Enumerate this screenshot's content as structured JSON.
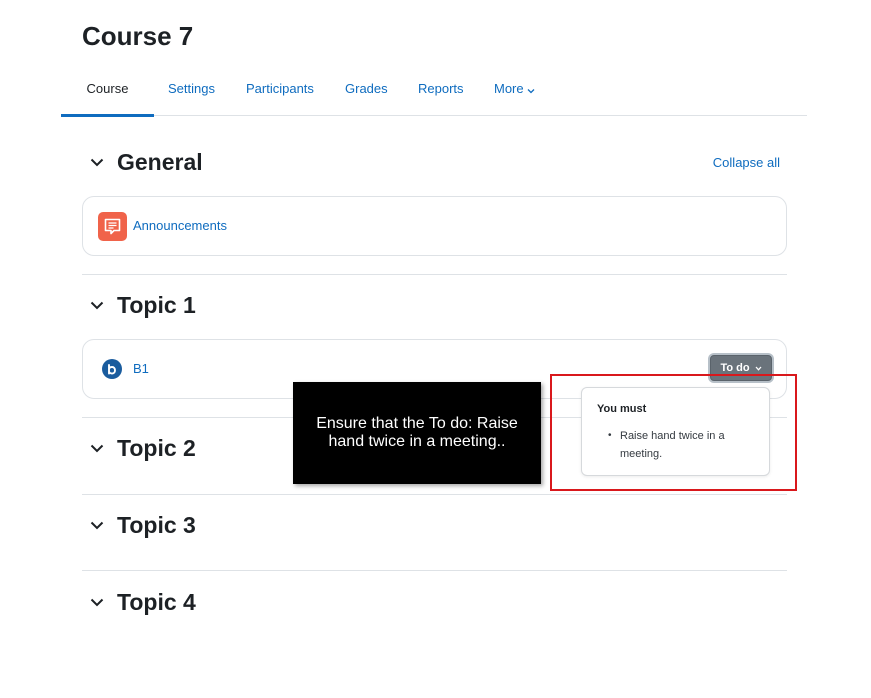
{
  "course": {
    "title": "Course 7"
  },
  "nav": {
    "tabs": [
      {
        "label": "Course",
        "active": true
      },
      {
        "label": "Settings"
      },
      {
        "label": "Participants"
      },
      {
        "label": "Grades"
      },
      {
        "label": "Reports"
      },
      {
        "label": "More"
      }
    ]
  },
  "actions": {
    "collapse_all": "Collapse all"
  },
  "sections": [
    {
      "title": "General",
      "activities": [
        {
          "name": "Announcements",
          "icon": "forum-icon"
        }
      ]
    },
    {
      "title": "Topic 1",
      "activities": [
        {
          "name": "B1",
          "icon": "bigbluebutton-icon",
          "completion_button": "To do"
        }
      ]
    },
    {
      "title": "Topic 2"
    },
    {
      "title": "Topic 3"
    },
    {
      "title": "Topic 4"
    }
  ],
  "completion_popover": {
    "heading": "You must",
    "items": [
      "Raise hand twice in a meeting."
    ]
  },
  "instruction_tooltip": {
    "text": "Ensure that the To do: Raise hand twice in a meeting.."
  },
  "colors": {
    "link": "#0f6cbf",
    "forum_icon_bg": "#f0634a",
    "bbb_icon_bg": "#1a5c9e",
    "highlight": "#d9181c"
  }
}
